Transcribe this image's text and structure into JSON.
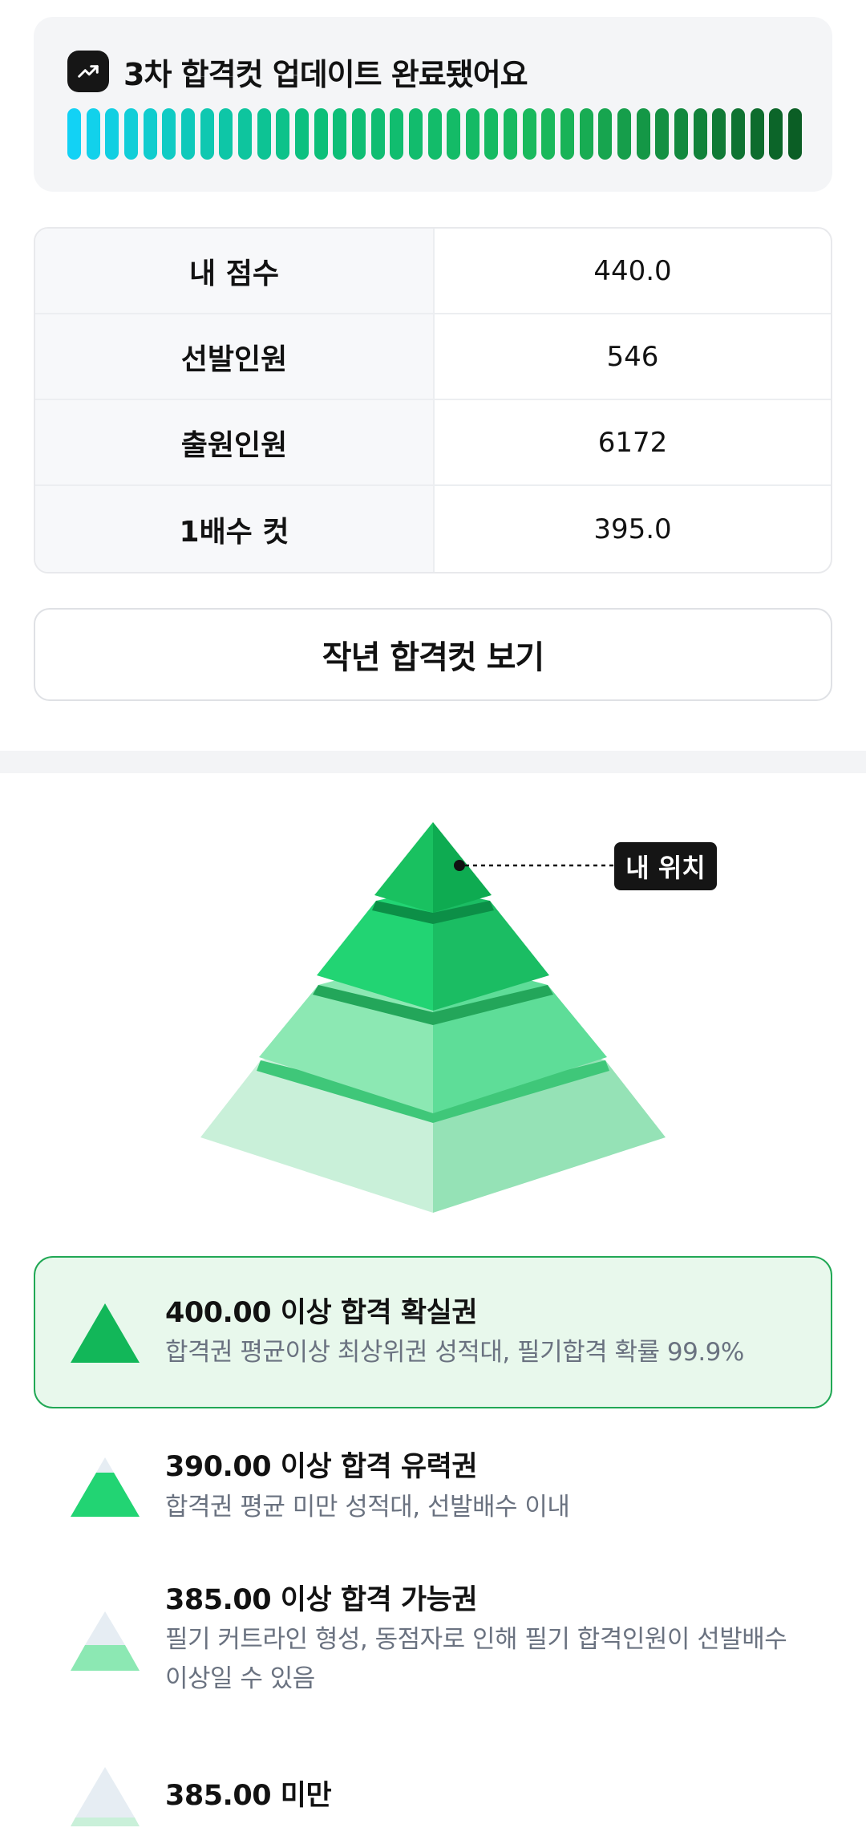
{
  "banner": {
    "icon": "trending-up-icon",
    "title": "3차 합격컷 업데이트 완료됐어요",
    "progress": 1.0,
    "bar_count": 39,
    "gradient_colors": [
      "#12d2f5",
      "#0cbf7a",
      "#1ab85a",
      "#0b5e25"
    ]
  },
  "score_table": {
    "rows": [
      {
        "label": "내 점수",
        "value": "440.0"
      },
      {
        "label": "선발인원",
        "value": "546"
      },
      {
        "label": "출원인원",
        "value": "6172"
      },
      {
        "label": "1배수 컷",
        "value": "395.0"
      }
    ]
  },
  "last_year_button": {
    "label": "작년 합격컷 보기"
  },
  "pyramid": {
    "my_position_label": "내 위치",
    "my_tier": 1,
    "colors": {
      "tier1_left": "#19c160",
      "tier1_right": "#0eab51",
      "tier2_left": "#22d473",
      "tier2_right": "#1bbd63",
      "tier3_left": "#8ce8b3",
      "tier3_right": "#5edd98",
      "tier4_left": "#c9f0d9",
      "tier4_right": "#95e2b6"
    }
  },
  "tiers": [
    {
      "title": "400.00 이상 합격 확실권",
      "desc": "합격권 평균이상 최상위권 성적대, 필기합격 확률 99.9%",
      "highlighted": true
    },
    {
      "title": "390.00 이상 합격 유력권",
      "desc": "합격권 평균 미만 성적대, 선발배수 이내",
      "highlighted": false
    },
    {
      "title": "385.00 이상 합격 가능권",
      "desc": "필기 커트라인 형성, 동점자로 인해 필기 합격인원이 선발배수 이상일 수 있음",
      "highlighted": false
    },
    {
      "title": "385.00 미만",
      "desc": "",
      "highlighted": false
    }
  ]
}
